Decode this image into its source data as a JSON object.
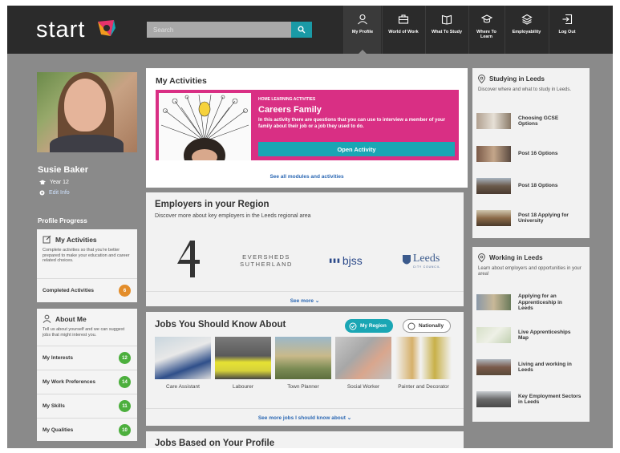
{
  "nav": {
    "logo_text": "start",
    "search_placeholder": "Search",
    "items": [
      {
        "label": "My Profile",
        "icon": "person-icon"
      },
      {
        "label": "World of Work",
        "icon": "briefcase-icon"
      },
      {
        "label": "What To Study",
        "icon": "book-icon"
      },
      {
        "label": "Where To Learn",
        "icon": "graduation-cap-icon"
      },
      {
        "label": "Employability",
        "icon": "layers-icon"
      },
      {
        "label": "Log Out",
        "icon": "logout-icon"
      }
    ]
  },
  "profile": {
    "name": "Susie Baker",
    "year": "Year 12",
    "edit": "Edit Info",
    "progress_title": "Profile Progress"
  },
  "my_activities_card": {
    "title": "My Activities",
    "desc": "Complete activities so that you're better prepared to make your education and career related choices.",
    "row_label": "Completed Activities",
    "row_count": "6"
  },
  "about_me_card": {
    "title": "About Me",
    "desc": "Tell us about yourself and we can suggest jobs that might interest you.",
    "rows": [
      {
        "label": "My Interests",
        "count": "12"
      },
      {
        "label": "My Work Preferences",
        "count": "14"
      },
      {
        "label": "My Skills",
        "count": "11"
      },
      {
        "label": "My Qualities",
        "count": "10"
      }
    ]
  },
  "activities": {
    "title": "My Activities",
    "subtitle": "HOME LEARNING ACTIVITIES",
    "headline": "Careers Family",
    "desc": "In this activity there are questions that you can use to interview a member of your family about their job or a job they used to do.",
    "button": "Open Activity",
    "link": "See all modules and activities"
  },
  "employers": {
    "title": "Employers in your Region",
    "desc": "Discover more about key employers in the Leeds regional area",
    "logos": [
      "4",
      "EVERSHEDS SUTHERLAND",
      "bjss",
      "Leeds"
    ],
    "leeds_sub": "CITY COUNCIL",
    "see_more": "See more"
  },
  "jobs": {
    "title": "Jobs You Should Know About",
    "filter_region": "My Region",
    "filter_national": "Nationally",
    "items": [
      "Care Assistant",
      "Labourer",
      "Town Planner",
      "Social Worker",
      "Painter and Decorator"
    ],
    "see_more": "See more jobs I should know about"
  },
  "jobs_profile": {
    "title": "Jobs Based on Your Profile"
  },
  "studying": {
    "title": "Studying in Leeds",
    "desc": "Discover where and what to study in Leeds.",
    "items": [
      "Choosing GCSE Options",
      "Post 16 Options",
      "Post 18 Options",
      "Post 18 Applying for University"
    ]
  },
  "working": {
    "title": "Working in Leeds",
    "desc": "Learn about employers and opportunities in your area!",
    "items": [
      "Applying for an Apprenticeship in Leeds",
      "Live Apprenticeships Map",
      "Living and working in Leeds",
      "Key Employment Sectors in Leeds"
    ]
  },
  "colors": {
    "nav_bg": "#2b2b2b",
    "accent_teal": "#1aa6b4",
    "accent_pink": "#d92f84",
    "badge_orange": "#e38d2a",
    "badge_green": "#4caf3d"
  }
}
